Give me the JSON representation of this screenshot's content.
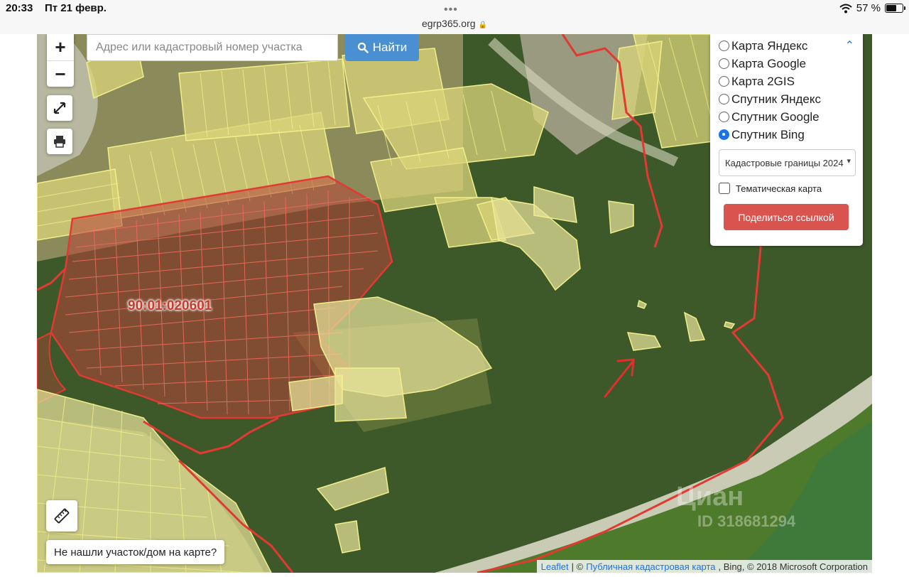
{
  "status_bar": {
    "time": "20:33",
    "date": "Пт 21 февр.",
    "dots": "•••",
    "url": "egrp365.org",
    "battery_text": "57 %",
    "battery_level": 0.57
  },
  "map": {
    "zoom_in": "+",
    "zoom_out": "−",
    "search_placeholder": "Адрес или кадастровый номер участка",
    "search_value": "",
    "find_button": "Найти",
    "cadastral_label": "90:01:020601",
    "not_found_button": "Не нашли участок/дом на карте?",
    "watermark_logo": "Циан",
    "watermark_id": "ID 318681294",
    "colors": {
      "parcel_fill": "#e8e39a",
      "parcel_stroke": "#f1ef8a",
      "boundary": "#e23a32",
      "button_blue": "#4a8fd2",
      "share_red": "#d9534f"
    }
  },
  "layers": {
    "items": [
      {
        "label": "Карта Яндекс",
        "selected": false
      },
      {
        "label": "Карта Google",
        "selected": false
      },
      {
        "label": "Карта 2GIS",
        "selected": false
      },
      {
        "label": "Спутник Яндекс",
        "selected": false
      },
      {
        "label": "Спутник Google",
        "selected": false
      },
      {
        "label": "Спутник Bing",
        "selected": true
      }
    ],
    "select_value": "Кадастровые границы 2024",
    "thematic_label": "Тематическая карта",
    "share_button": "Поделиться ссылкой"
  },
  "attribution": {
    "leaflet": "Leaflet",
    "sep": "| ©",
    "cadastral_map": "Публичная кадастровая карта",
    "rest": ", Bing, © 2018 Microsoft Corporation"
  }
}
